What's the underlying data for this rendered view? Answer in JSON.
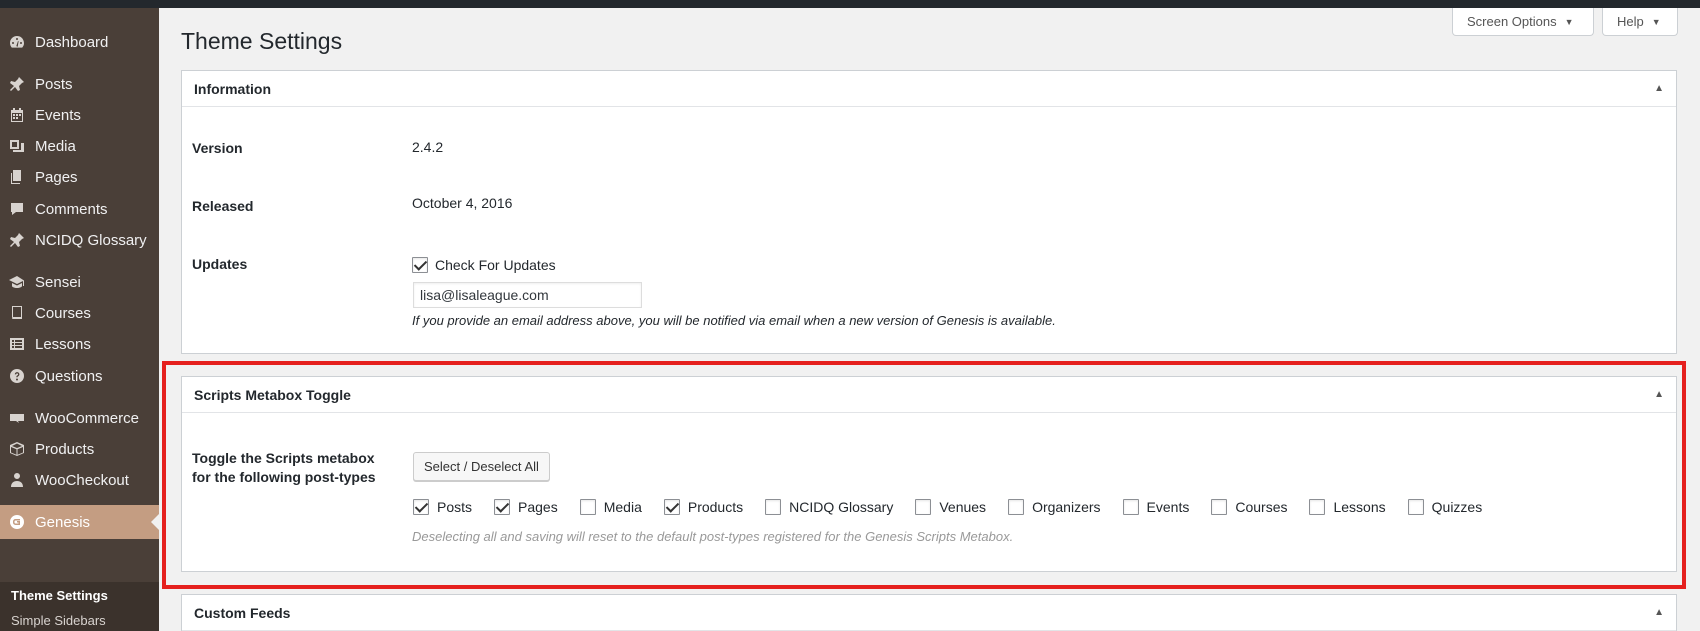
{
  "sidebar": {
    "items": [
      {
        "label": "Dashboard",
        "icon": "dashboard-icon"
      },
      {
        "label": "Posts",
        "icon": "pin-icon"
      },
      {
        "label": "Events",
        "icon": "calendar-icon"
      },
      {
        "label": "Media",
        "icon": "media-icon"
      },
      {
        "label": "Pages",
        "icon": "pages-icon"
      },
      {
        "label": "Comments",
        "icon": "comment-icon"
      },
      {
        "label": "NCIDQ Glossary",
        "icon": "pin-icon"
      },
      {
        "label": "Sensei",
        "icon": "graduation-cap-icon"
      },
      {
        "label": "Courses",
        "icon": "book-icon"
      },
      {
        "label": "Lessons",
        "icon": "list-icon"
      },
      {
        "label": "Questions",
        "icon": "question-icon"
      },
      {
        "label": "WooCommerce",
        "icon": "woo-icon"
      },
      {
        "label": "Products",
        "icon": "box-icon"
      },
      {
        "label": "WooCheckout",
        "icon": "person-icon"
      },
      {
        "label": "Genesis",
        "icon": "genesis-icon"
      }
    ],
    "submenu": [
      "Theme Settings",
      "Simple Sidebars"
    ]
  },
  "header": {
    "screen_options": "Screen Options",
    "help": "Help",
    "dropdown_arrow": "▼"
  },
  "page": {
    "title": "Theme Settings"
  },
  "information": {
    "title": "Information",
    "toggle": "▲",
    "version_label": "Version",
    "version_value": "2.4.2",
    "released_label": "Released",
    "released_value": "October 4, 2016",
    "updates_label": "Updates",
    "check_updates_label": "Check For Updates",
    "check_updates_checked": true,
    "email_value": "lisa@lisaleague.com",
    "email_desc": "If you provide an email address above, you will be notified via email when a new version of Genesis is available."
  },
  "scripts": {
    "title": "Scripts Metabox Toggle",
    "toggle": "▲",
    "label_line1": "Toggle the Scripts metabox",
    "label_line2": "for the following post-types",
    "select_all_button": "Select / Deselect All",
    "post_types": [
      {
        "label": "Posts",
        "checked": true
      },
      {
        "label": "Pages",
        "checked": true
      },
      {
        "label": "Media",
        "checked": false
      },
      {
        "label": "Products",
        "checked": true
      },
      {
        "label": "NCIDQ Glossary",
        "checked": false
      },
      {
        "label": "Venues",
        "checked": false
      },
      {
        "label": "Organizers",
        "checked": false
      },
      {
        "label": "Events",
        "checked": false
      },
      {
        "label": "Courses",
        "checked": false
      },
      {
        "label": "Lessons",
        "checked": false
      },
      {
        "label": "Quizzes",
        "checked": false
      }
    ],
    "desc": "Deselecting all and saving will reset to the default post-types registered for the Genesis Scripts Metabox."
  },
  "custom_feeds": {
    "title": "Custom Feeds",
    "toggle": "▲"
  },
  "colors": {
    "sidebar_bg": "#4a3f38",
    "sidebar_current": "#c49d82",
    "highlight_border": "#e5201e"
  }
}
